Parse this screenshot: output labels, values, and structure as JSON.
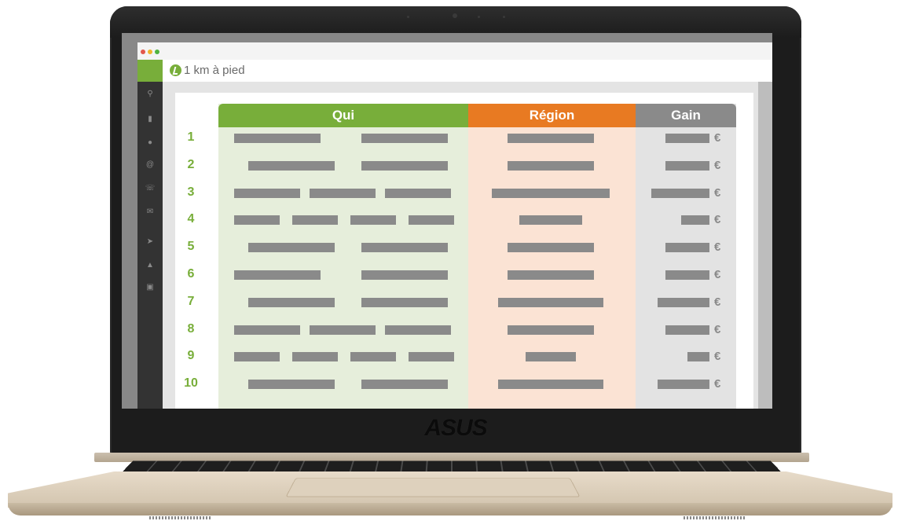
{
  "device": {
    "brand": "ASUS"
  },
  "app": {
    "title": "1 km à pied"
  },
  "table": {
    "headers": {
      "qui": "Qui",
      "region": "Région",
      "gain": "Gain"
    },
    "ranks": [
      "1",
      "2",
      "3",
      "4",
      "5",
      "6",
      "7",
      "8",
      "9",
      "10"
    ],
    "currency": "€"
  },
  "sidebar": {
    "icons": [
      "search-icon",
      "bar-chart-icon",
      "chat-icon",
      "at-icon",
      "phone-icon",
      "mail-icon",
      "send-icon",
      "user-icon",
      "clipboard-icon"
    ]
  },
  "colors": {
    "green": "#78ae3a",
    "orange": "#e87a22",
    "grey": "#8a8a8a",
    "qui_bg": "#e6eedb",
    "region_bg": "#fbe3d4",
    "gain_bg": "#e3e3e3"
  }
}
